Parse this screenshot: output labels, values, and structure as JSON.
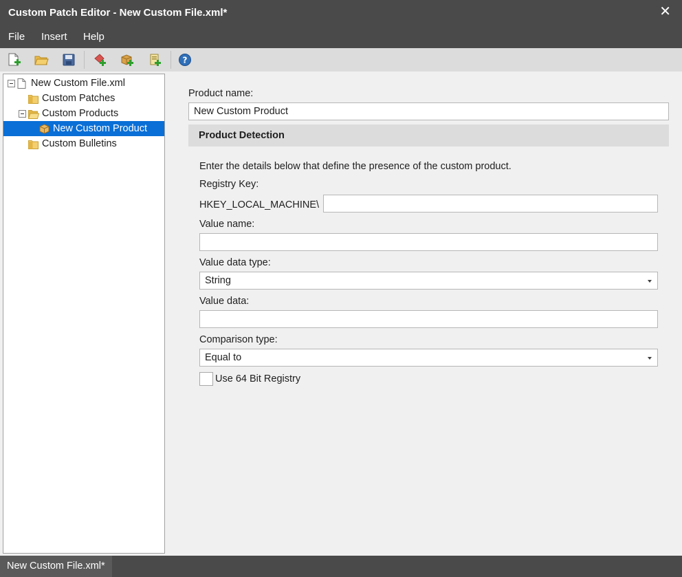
{
  "window": {
    "title": "Custom Patch Editor - New Custom File.xml*",
    "close_glyph": "✕"
  },
  "menu": {
    "file": "File",
    "insert": "Insert",
    "help": "Help"
  },
  "toolbar": {
    "icons": [
      "new-file-icon",
      "open-folder-icon",
      "save-icon",
      "add-patch-icon",
      "add-product-icon",
      "add-bulletin-icon",
      "help-icon"
    ]
  },
  "tree": {
    "root": "New Custom File.xml",
    "patches": "Custom Patches",
    "products": "Custom Products",
    "product_item": "New Custom Product",
    "bulletins": "Custom Bulletins"
  },
  "form": {
    "product_name_label": "Product name:",
    "product_name_value": "New Custom Product",
    "section_title": "Product Detection",
    "description": "Enter the details below that define the presence of the custom product.",
    "registry_key_label": "Registry Key:",
    "registry_prefix": "HKEY_LOCAL_MACHINE\\",
    "registry_key_value": "",
    "value_name_label": "Value name:",
    "value_name_value": "",
    "value_data_type_label": "Value data type:",
    "value_data_type_selected": "String",
    "value_data_label": "Value data:",
    "value_data_value": "",
    "comparison_type_label": "Comparison type:",
    "comparison_type_selected": "Equal to",
    "use64_label": "Use 64 Bit Registry",
    "use64_checked": false
  },
  "status": {
    "tab_label": "New Custom File.xml*"
  },
  "colors": {
    "chrome": "#4a4a4a",
    "selection": "#0a6fd6",
    "toolbar": "#dcdcdc"
  }
}
